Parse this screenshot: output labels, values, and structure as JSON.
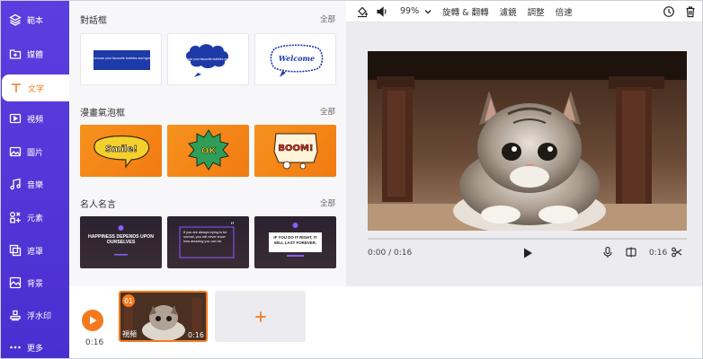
{
  "sidebar": {
    "items": [
      {
        "label": "範本",
        "icon": "layers-icon"
      },
      {
        "label": "媒體",
        "icon": "folder-plus-icon"
      },
      {
        "label": "文字",
        "icon": "text-icon",
        "active": true
      },
      {
        "label": "視頻",
        "icon": "video-icon"
      },
      {
        "label": "圖片",
        "icon": "image-icon"
      },
      {
        "label": "音樂",
        "icon": "music-icon"
      },
      {
        "label": "元素",
        "icon": "elements-icon"
      },
      {
        "label": "遮罩",
        "icon": "overlay-icon"
      },
      {
        "label": "背景",
        "icon": "background-icon"
      },
      {
        "label": "浮水印",
        "icon": "watermark-icon"
      },
      {
        "label": "更多",
        "icon": "more-icon"
      }
    ]
  },
  "panel": {
    "sections": [
      {
        "title": "對話框",
        "all_label": "全部",
        "thumbs": [
          {
            "text": "Just choose your favourite bubbles and type text",
            "style": "white"
          },
          {
            "text": "Just choose your favourite bubbles and type text",
            "style": "white"
          },
          {
            "text": "Welcome",
            "style": "white"
          }
        ]
      },
      {
        "title": "漫畫氣泡框",
        "all_label": "全部",
        "thumbs": [
          {
            "text": "Smile!",
            "style": "orange"
          },
          {
            "text": "OK",
            "style": "orange"
          },
          {
            "text": "BOOM!",
            "style": "orange"
          }
        ]
      },
      {
        "title": "名人名言",
        "all_label": "全部",
        "thumbs": [
          {
            "text": "HAPPINESS DEPENDS UPON OURSELVES",
            "style": "dark"
          },
          {
            "text": "If you are always trying to be normal, you will never know how amazing you can be.",
            "style": "dark"
          },
          {
            "text": "IF YOU DO IT RIGHT, IT WILL LAST FOREVER.",
            "style": "dark"
          }
        ]
      }
    ]
  },
  "toolbar": {
    "zoom": "99%",
    "rotate_label": "旋轉 & 翻轉",
    "filter_label": "濾鏡",
    "adjust_label": "調整",
    "speed_label": "倍速"
  },
  "player": {
    "current_time": "0:00",
    "duration": "0:16",
    "time_display": "0:00 / 0:16",
    "progress": 0,
    "end_time": "0:16"
  },
  "timeline": {
    "total_time": "0:16",
    "clip": {
      "index": "01",
      "label": "視頻",
      "duration": "0:16"
    }
  },
  "colors": {
    "accent": "#f47a1f",
    "sidebar": "#5b3ee0"
  }
}
